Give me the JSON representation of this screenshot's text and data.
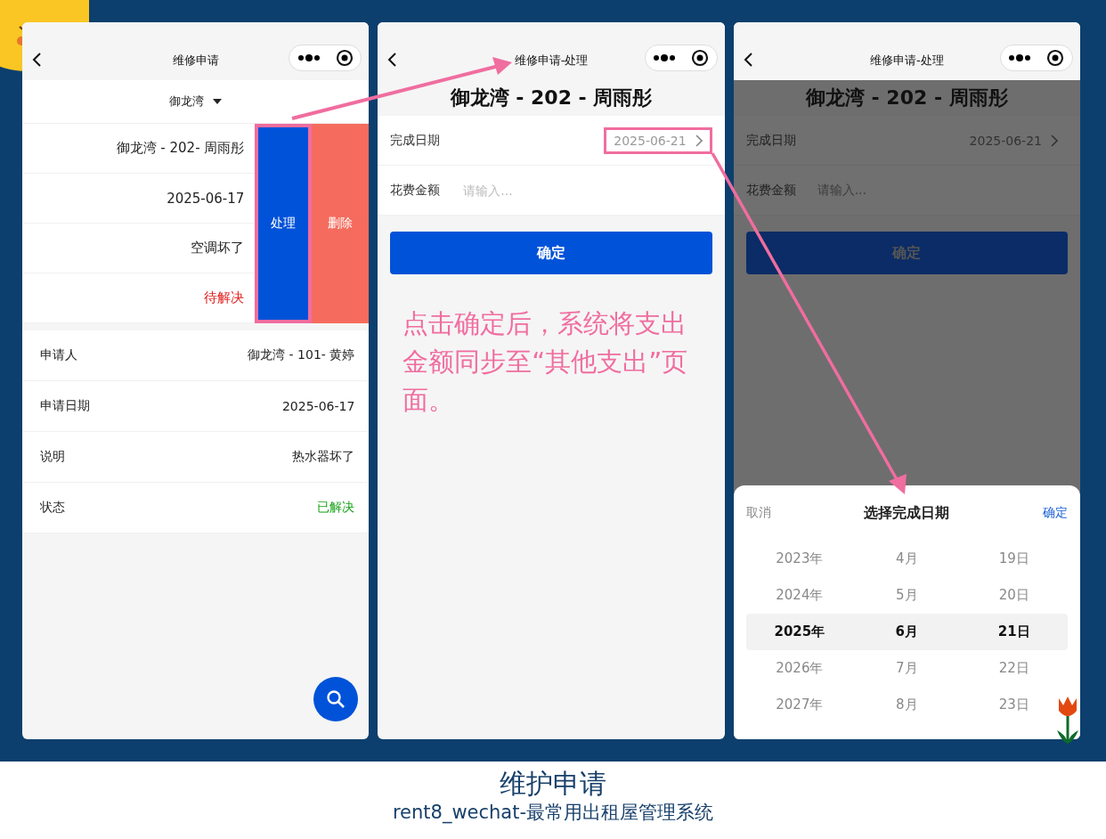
{
  "list_screen": {
    "title": "维修申请",
    "filter": "御龙湾",
    "swiped_card": {
      "rows": [
        {
          "value": "御龙湾 - 202- 周雨彤"
        },
        {
          "value": "2025-06-17"
        },
        {
          "value": "空调坏了"
        },
        {
          "value": "待解决",
          "color": "#e02020"
        }
      ],
      "actions": [
        {
          "label": "处理",
          "kind": "process",
          "highlighted": true
        },
        {
          "label": "删除",
          "kind": "delete",
          "highlighted": false
        }
      ]
    },
    "card": {
      "rows": [
        {
          "label": "申请人",
          "value": "御龙湾 - 101- 黄婷"
        },
        {
          "label": "申请日期",
          "value": "2025-06-17"
        },
        {
          "label": "说明",
          "value": "热水器坏了"
        },
        {
          "label": "状态",
          "value": "已解决",
          "color": "#16a016"
        }
      ]
    }
  },
  "process_screen": {
    "title": "维修申请-处理",
    "heading": "御龙湾 - 202 - 周雨彤",
    "date_label": "完成日期",
    "date_value": "2025-06-21",
    "date_highlighted": true,
    "amount_label": "花费金额",
    "amount_placeholder": "请输入...",
    "confirm": "确定",
    "note": "点击确定后，系统将支出金额同步至“其他支出”页面。"
  },
  "picker_screen": {
    "title": "维修申请-处理",
    "heading": "御龙湾 - 202 - 周雨彤",
    "date_label": "完成日期",
    "date_value": "2025-06-21",
    "amount_label": "花费金额",
    "amount_placeholder": "请输入...",
    "confirm": "确定",
    "sheet": {
      "cancel": "取消",
      "title": "选择完成日期",
      "ok": "确定",
      "columns": [
        [
          {
            "label": "2023年",
            "selected": false
          },
          {
            "label": "2024年",
            "selected": false
          },
          {
            "label": "2025年",
            "selected": true
          },
          {
            "label": "2026年",
            "selected": false
          },
          {
            "label": "2027年",
            "selected": false
          }
        ],
        [
          {
            "label": "4月",
            "selected": false
          },
          {
            "label": "5月",
            "selected": false
          },
          {
            "label": "6月",
            "selected": true
          },
          {
            "label": "7月",
            "selected": false
          },
          {
            "label": "8月",
            "selected": false
          }
        ],
        [
          {
            "label": "19日",
            "selected": false
          },
          {
            "label": "20日",
            "selected": false
          },
          {
            "label": "21日",
            "selected": true
          },
          {
            "label": "22日",
            "selected": false
          },
          {
            "label": "23日",
            "selected": false
          }
        ]
      ]
    }
  },
  "caption": {
    "title": "维护申请",
    "subtitle": "rent8_wechat-最常用出租屋管理系统"
  }
}
